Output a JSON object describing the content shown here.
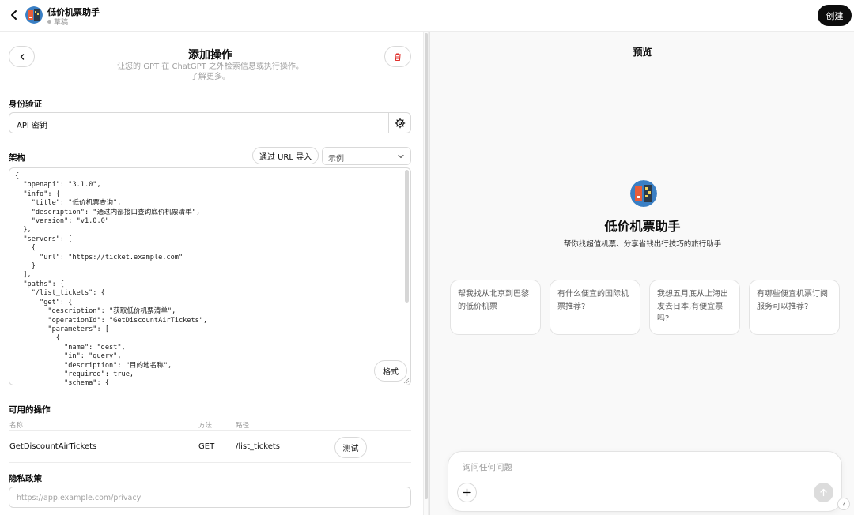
{
  "header": {
    "gpt_name": "低价机票助手",
    "status": "草稿",
    "create_label": "创建"
  },
  "editor": {
    "title": "添加操作",
    "subtitle_line1": "让您的 GPT 在 ChatGPT 之外检索信息或执行操作。",
    "subtitle_line2": "了解更多。",
    "auth": {
      "label": "身份验证",
      "value": "API 密钥"
    },
    "schema": {
      "label": "架构",
      "import_url_label": "通过 URL 导入",
      "example_select": "示例",
      "code": "{\n  \"openapi\": \"3.1.0\",\n  \"info\": {\n    \"title\": \"低价机票查询\",\n    \"description\": \"通过内部接口查询底价机票清单\",\n    \"version\": \"v1.0.0\"\n  },\n  \"servers\": [\n    {\n      \"url\": \"https://ticket.example.com\"\n    }\n  ],\n  \"paths\": {\n    \"/list_tickets\": {\n      \"get\": {\n        \"description\": \"获取低价机票清单\",\n        \"operationId\": \"GetDiscountAirTickets\",\n        \"parameters\": [\n          {\n            \"name\": \"dest\",\n            \"in\": \"query\",\n            \"description\": \"目的地名称\",\n            \"required\": true,\n            \"schema\": {",
      "format_label": "格式"
    },
    "actions": {
      "label": "可用的操作",
      "columns": [
        "名称",
        "方法",
        "路径"
      ],
      "rows": [
        {
          "name": "GetDiscountAirTickets",
          "method": "GET",
          "path": "/list_tickets",
          "test_label": "测试"
        }
      ]
    },
    "privacy": {
      "label": "隐私政策",
      "placeholder": "https://app.example.com/privacy"
    }
  },
  "preview": {
    "title": "预览",
    "gpt_name": "低价机票助手",
    "description": "帮你找超值机票、分享省钱出行技巧的旅行助手",
    "starters": [
      "帮我找从北京到巴黎的低价机票",
      "有什么便宜的国际机票推荐?",
      "我想五月底从上海出发去日本,有便宜票吗?",
      "有哪些便宜机票订阅服务可以推荐?"
    ],
    "composer_placeholder": "询问任何问题",
    "help_label": "?"
  },
  "icons": {
    "back": "chevron-left-icon",
    "delete": "trash-icon",
    "settings": "gear-icon",
    "dropdown": "chevron-down-icon",
    "attach": "plus-icon",
    "send": "arrow-up-icon"
  },
  "colors": {
    "primary": "#0d0d0d",
    "delete": "#e02e2a",
    "preview_bg": "#f9f9f9"
  }
}
